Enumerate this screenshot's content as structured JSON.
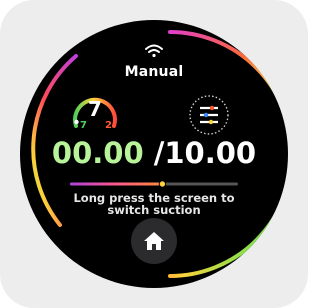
{
  "header": {
    "wifi_icon": "wifi-icon",
    "mode_label": "Manual"
  },
  "suction": {
    "level": "7",
    "min_label": "7",
    "max_label": "2",
    "gauge_fraction": 0.6
  },
  "settings": {
    "icon": "sliders-icon"
  },
  "timer": {
    "elapsed": "00.00",
    "total": "/10.00",
    "progress_fraction": 0.55
  },
  "hint": {
    "line1": "Long press the screen to",
    "line2": "switch suction"
  },
  "home": {
    "icon": "home-icon"
  },
  "colors": {
    "background": "#000000",
    "elapsed": "#b8f39a",
    "accent_green": "#4fd05a",
    "accent_orange": "#ff5a2e",
    "ring_purple": "#c040e0"
  }
}
